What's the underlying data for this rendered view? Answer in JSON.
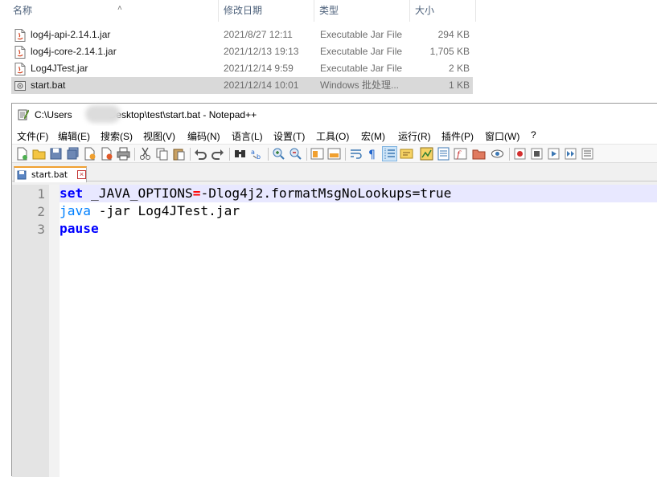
{
  "explorer": {
    "columns": {
      "name": "名称",
      "date": "修改日期",
      "type": "类型",
      "size": "大小"
    },
    "files": [
      {
        "name": "log4j-api-2.14.1.jar",
        "date": "2021/8/27 12:11",
        "type": "Executable Jar File",
        "size": "294 KB",
        "icon": "jar-file-icon"
      },
      {
        "name": "log4j-core-2.14.1.jar",
        "date": "2021/12/13 19:13",
        "type": "Executable Jar File",
        "size": "1,705 KB",
        "icon": "jar-file-icon"
      },
      {
        "name": "Log4JTest.jar",
        "date": "2021/12/14 9:59",
        "type": "Executable Jar File",
        "size": "2 KB",
        "icon": "jar-file-icon"
      },
      {
        "name": "start.bat",
        "date": "2021/12/14 10:01",
        "type": "Windows 批处理...",
        "size": "1 KB",
        "icon": "bat-file-icon",
        "selected": true
      }
    ]
  },
  "notepad": {
    "title_prefix": "C:\\Users",
    "title_suffix": "Desktop\\test\\start.bat - Notepad++",
    "menu": [
      "文件(F)",
      "编辑(E)",
      "搜索(S)",
      "视图(V)",
      "编码(N)",
      "语言(L)",
      "设置(T)",
      "工具(O)",
      "宏(M)",
      "运行(R)",
      "插件(P)",
      "窗口(W)",
      "?"
    ],
    "tab": {
      "label": "start.bat",
      "close": "×"
    },
    "editor": {
      "line_numbers": [
        "1",
        "2",
        "3"
      ],
      "lines": [
        {
          "tokens": [
            {
              "t": "set",
              "c": "kw"
            },
            {
              "t": " _JAVA_OPTIONS",
              "c": ""
            },
            {
              "t": "=",
              "c": "op"
            },
            {
              "t": "-Dlog4j2.formatMsgNoLookups=true",
              "c": ""
            }
          ]
        },
        {
          "tokens": [
            {
              "t": "java",
              "c": "cmd"
            },
            {
              "t": " -jar Log4JTest.jar",
              "c": ""
            }
          ]
        },
        {
          "tokens": [
            {
              "t": "pause",
              "c": "kw"
            }
          ]
        }
      ],
      "current_line": 1
    },
    "colors": {
      "keyword": "#0000ff",
      "command": "#0080ff",
      "operator": "#ff0000",
      "current_line": "#e8e8ff"
    }
  }
}
